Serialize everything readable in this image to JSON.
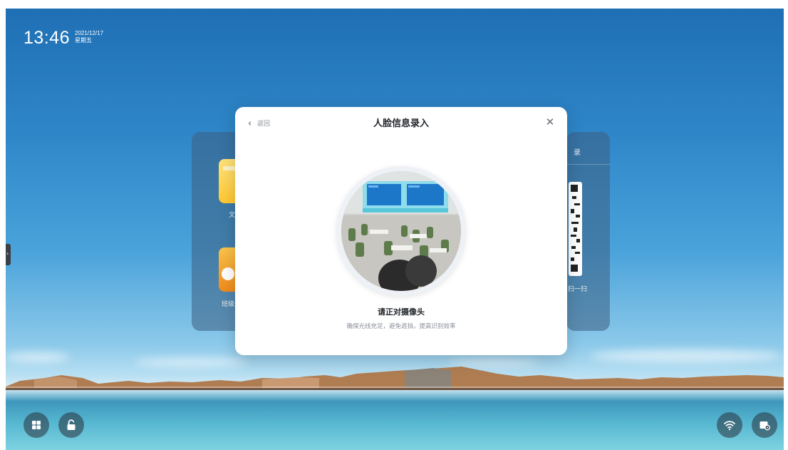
{
  "status_bar": {
    "time": "13:46",
    "date": "2021/12/17",
    "weekday": "星期五"
  },
  "background_panels": {
    "left_labels": [
      "文",
      "班级"
    ],
    "right_labels": [
      "录",
      "扫一扫"
    ]
  },
  "modal": {
    "back_label": "返回",
    "title": "人脸信息录入",
    "instruction": "请正对摄像头",
    "hint": "确保光线充足，避免遮挡，提高识别效率"
  },
  "taskbar": {
    "left_icons": [
      "windows-icon",
      "unlock-icon"
    ],
    "right_icons": [
      "wifi-icon",
      "settings-icon"
    ]
  },
  "colors": {
    "modal_bg": "#ffffff",
    "title_text": "#1f2329",
    "hint_text": "#8a8f99"
  }
}
